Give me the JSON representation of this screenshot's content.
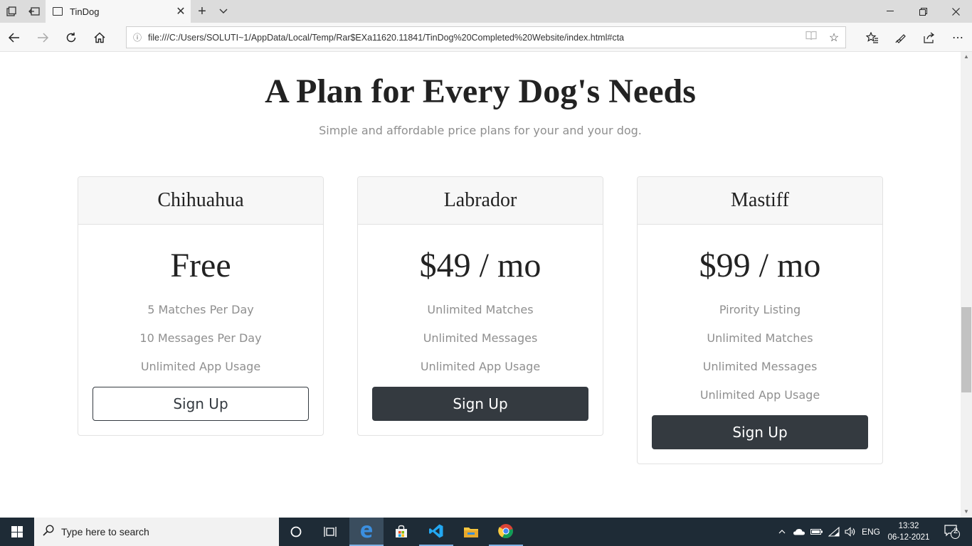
{
  "browser": {
    "tab": {
      "title": "TinDog"
    },
    "url": "file:///C:/Users/SOLUTI~1/AppData/Local/Temp/Rar$EXa11620.11841/TinDog%20Completed%20Website/index.html#cta"
  },
  "page": {
    "heading": "A Plan for Every Dog's Needs",
    "subheading": "Simple and affordable price plans for your and your dog.",
    "plans": [
      {
        "name": "Chihuahua",
        "price": "Free",
        "features": [
          "5 Matches Per Day",
          "10 Messages Per Day",
          "Unlimited App Usage"
        ],
        "button": "Sign Up",
        "button_style": "outline"
      },
      {
        "name": "Labrador",
        "price": "$49 / mo",
        "features": [
          "Unlimited Matches",
          "Unlimited Messages",
          "Unlimited App Usage"
        ],
        "button": "Sign Up",
        "button_style": "dark"
      },
      {
        "name": "Mastiff",
        "price": "$99 / mo",
        "features": [
          "Pirority Listing",
          "Unlimited Matches",
          "Unlimited Messages",
          "Unlimited App Usage"
        ],
        "button": "Sign Up",
        "button_style": "dark"
      }
    ]
  },
  "taskbar": {
    "search_placeholder": "Type here to search",
    "language": "ENG",
    "time": "13:32",
    "date": "06-12-2021",
    "notification_count": "2"
  },
  "colors": {
    "accent_dark": "#343a40",
    "muted_text": "#8f8f8f",
    "taskbar_bg": "#1e2b36"
  }
}
